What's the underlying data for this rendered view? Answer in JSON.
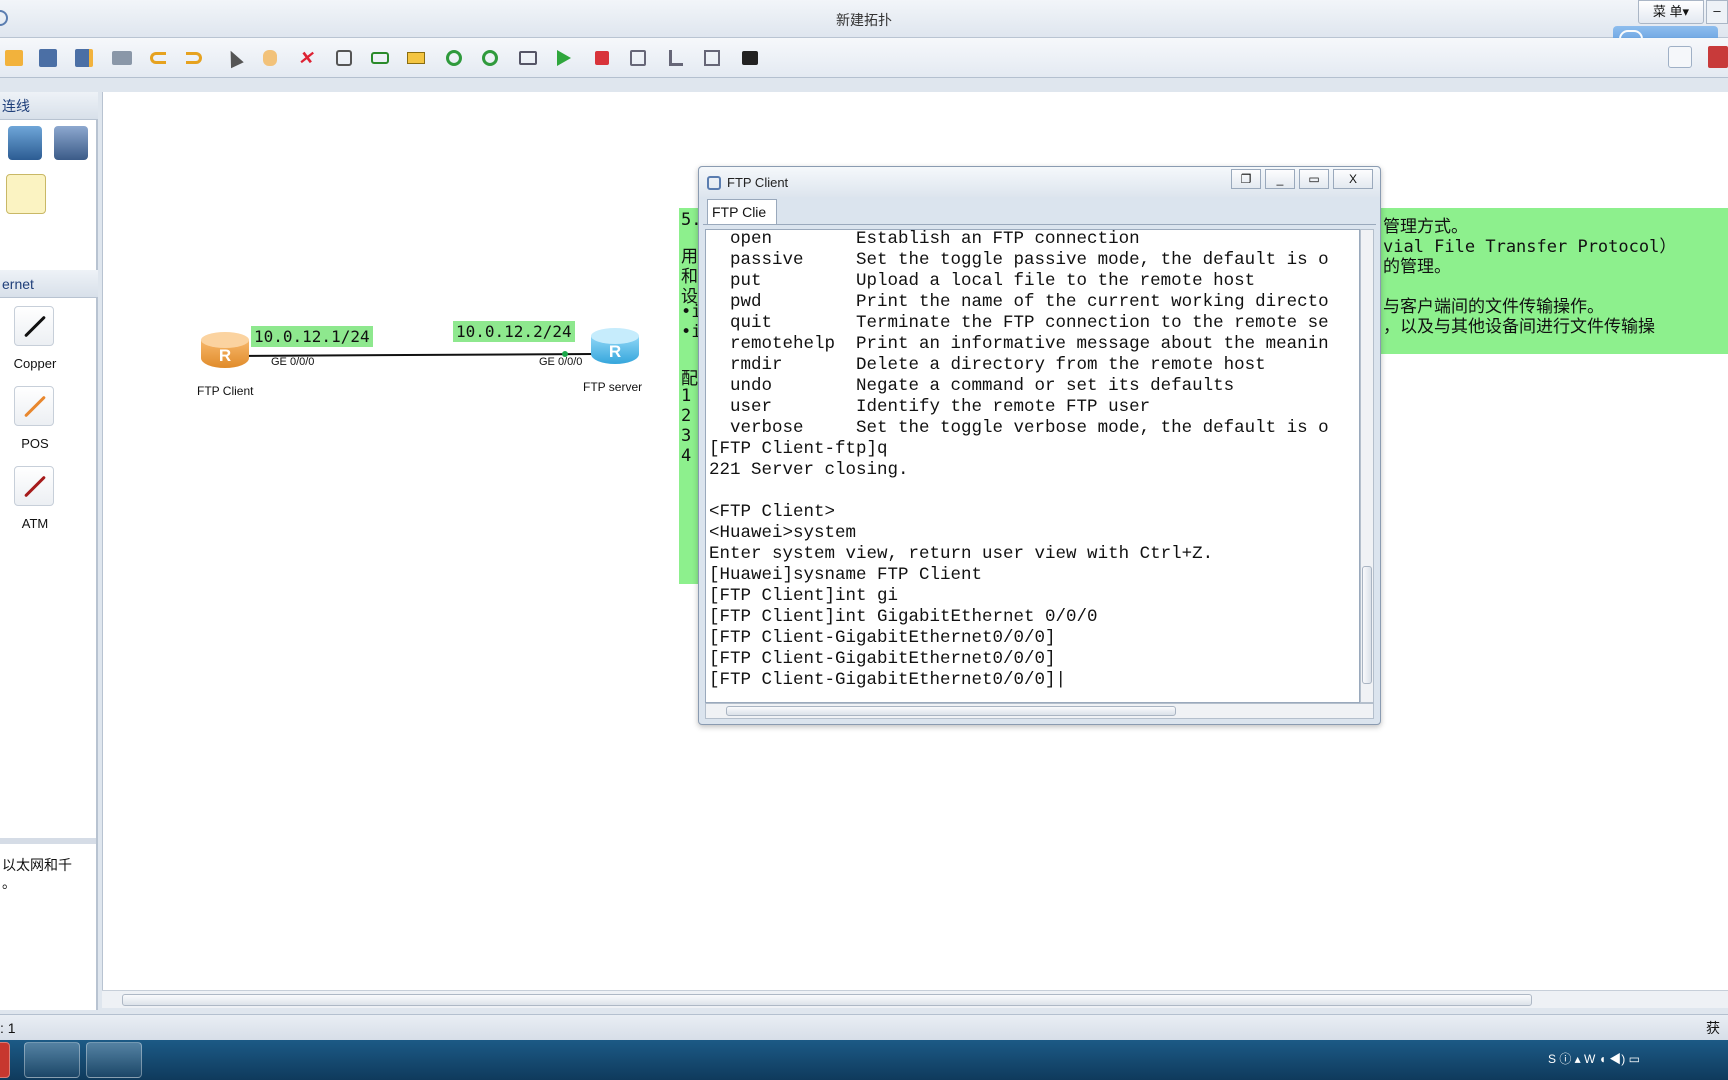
{
  "app": {
    "title": "新建拓扑",
    "menu_label": "菜 单▾",
    "min_label": "–",
    "badge_text": "...",
    "status_left": ": 1",
    "status_right": "获取"
  },
  "left_panel": {
    "section1_title": "连线",
    "section2_title": "ernet",
    "cables": [
      {
        "label": "Copper",
        "color": "#111111"
      },
      {
        "label": "POS",
        "color": "#e8872e"
      },
      {
        "label": "ATM",
        "color": "#a61b1b"
      }
    ],
    "description_line1": "以太网和千",
    "description_line2": "。"
  },
  "topology": {
    "client_label": "FTP Client",
    "server_label": "FTP server",
    "client_ip": "10.0.12.1/24",
    "server_ip": "10.0.12.2/24",
    "client_port": "GE 0/0/0",
    "server_port": "GE 0/0/0",
    "note_left_chars": [
      "5.",
      "用",
      "和",
      "设",
      "•i",
      "•i",
      "",
      "配",
      "1",
      "2",
      "3",
      "4"
    ],
    "note_right_lines": [
      "管理方式。",
      "vial File Transfer Protocol）",
      "的管理。",
      "",
      "与客户端间的文件传输操作。",
      "，以及与其他设备间进行文件传输操"
    ]
  },
  "ftp_window": {
    "title": "FTP Client",
    "tab_label": "FTP Clie",
    "restore_label": "❐",
    "minimize_label": "_",
    "maximize_label": "▭",
    "close_label": "X",
    "terminal_lines": [
      "  open        Establish an FTP connection",
      "  passive     Set the toggle passive mode, the default is o",
      "  put         Upload a local file to the remote host",
      "  pwd         Print the name of the current working directo",
      "  quit        Terminate the FTP connection to the remote se",
      "  remotehelp  Print an informative message about the meanin",
      "  rmdir       Delete a directory from the remote host",
      "  undo        Negate a command or set its defaults",
      "  user        Identify the remote FTP user",
      "  verbose     Set the toggle verbose mode, the default is o",
      "[FTP Client-ftp]q",
      "221 Server closing.",
      "",
      "<FTP Client>",
      "<Huawei>system",
      "Enter system view, return user view with Ctrl+Z.",
      "[Huawei]sysname FTP Client",
      "[FTP Client]int gi",
      "[FTP Client]int GigabitEthernet 0/0/0",
      "[FTP Client-GigabitEthernet0/0/0]",
      "[FTP Client-GigabitEthernet0/0/0]",
      "[FTP Client-GigabitEthernet0/0/0]|"
    ]
  },
  "colors": {
    "router_client": "#f2a14a",
    "router_server": "#5cc0ee",
    "highlight_green": "#8df08d"
  }
}
